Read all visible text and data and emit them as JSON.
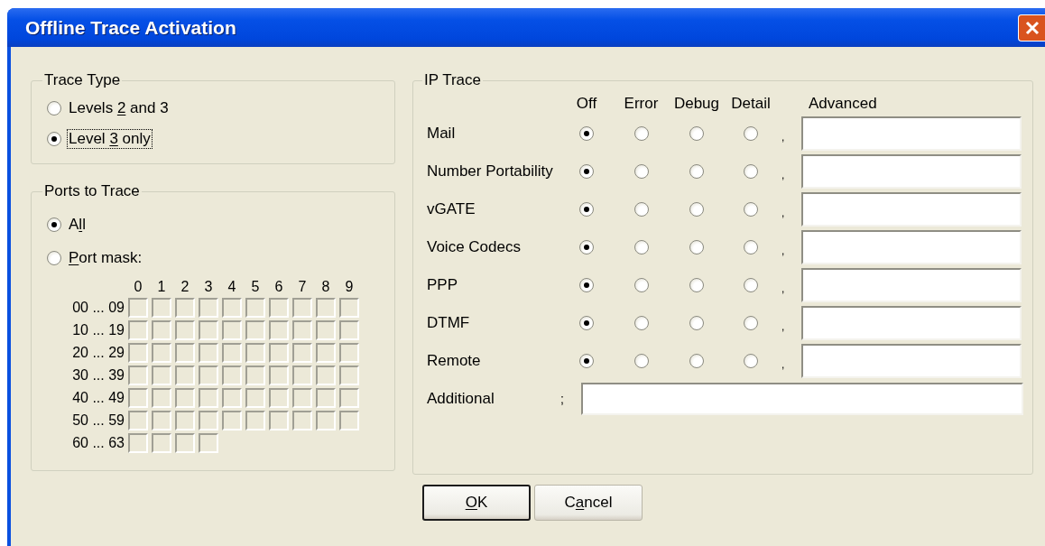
{
  "window": {
    "title": "Offline Trace Activation"
  },
  "trace_type": {
    "title": "Trace Type",
    "options": [
      {
        "label": {
          "before": "Levels ",
          "key": "2",
          "after": " and 3"
        },
        "selected": false,
        "focused": false
      },
      {
        "label": {
          "before": "Level ",
          "key": "3",
          "after": " only"
        },
        "selected": true,
        "focused": true
      }
    ]
  },
  "ports_to_trace": {
    "title": "Ports to Trace",
    "options": [
      {
        "label": {
          "before": "A",
          "key": "l",
          "after": "l"
        },
        "selected": true,
        "focused": false
      },
      {
        "label": {
          "key": "P",
          "after": "ort mask:"
        },
        "selected": false,
        "focused": false
      }
    ],
    "port_mask": {
      "column_headers": [
        "0",
        "1",
        "2",
        "3",
        "4",
        "5",
        "6",
        "7",
        "8",
        "9"
      ],
      "rows": [
        {
          "label": "00 ... 09",
          "boxes": [
            {
              "checked": false
            },
            {
              "checked": false
            },
            {
              "checked": false
            },
            {
              "checked": false
            },
            {
              "checked": false
            },
            {
              "checked": false
            },
            {
              "checked": false
            },
            {
              "checked": false
            },
            {
              "checked": false
            },
            {
              "checked": false
            }
          ]
        },
        {
          "label": "10 ... 19",
          "boxes": [
            {
              "checked": false
            },
            {
              "checked": false
            },
            {
              "checked": false
            },
            {
              "checked": false
            },
            {
              "checked": false
            },
            {
              "checked": false
            },
            {
              "checked": false
            },
            {
              "checked": false
            },
            {
              "checked": false
            },
            {
              "checked": false
            }
          ]
        },
        {
          "label": "20 ... 29",
          "boxes": [
            {
              "checked": false
            },
            {
              "checked": false
            },
            {
              "checked": false
            },
            {
              "checked": false
            },
            {
              "checked": false
            },
            {
              "checked": false
            },
            {
              "checked": false
            },
            {
              "checked": false
            },
            {
              "checked": false
            },
            {
              "checked": false
            }
          ]
        },
        {
          "label": "30 ... 39",
          "boxes": [
            {
              "checked": false
            },
            {
              "checked": false
            },
            {
              "checked": false
            },
            {
              "checked": false
            },
            {
              "checked": false
            },
            {
              "checked": false
            },
            {
              "checked": false
            },
            {
              "checked": false
            },
            {
              "checked": false
            },
            {
              "checked": false
            }
          ]
        },
        {
          "label": "40 ... 49",
          "boxes": [
            {
              "checked": false
            },
            {
              "checked": false
            },
            {
              "checked": false
            },
            {
              "checked": false
            },
            {
              "checked": false
            },
            {
              "checked": false
            },
            {
              "checked": false
            },
            {
              "checked": false
            },
            {
              "checked": false
            },
            {
              "checked": false
            }
          ]
        },
        {
          "label": "50 ... 59",
          "boxes": [
            {
              "checked": false
            },
            {
              "checked": false
            },
            {
              "checked": false
            },
            {
              "checked": false
            },
            {
              "checked": false
            },
            {
              "checked": false
            },
            {
              "checked": false
            },
            {
              "checked": false
            },
            {
              "checked": false
            },
            {
              "checked": false
            }
          ]
        },
        {
          "label": "60 ... 63",
          "boxes": [
            {
              "checked": false
            },
            {
              "checked": false
            },
            {
              "checked": false
            },
            {
              "checked": false
            }
          ]
        }
      ]
    }
  },
  "ip_trace": {
    "title": "IP Trace",
    "columns": [
      "Off",
      "Error",
      "Debug",
      "Detail"
    ],
    "advanced_heading": "Advanced",
    "rows": [
      {
        "label": "Mail",
        "levels": [
          {
            "selected": true
          },
          {
            "selected": false
          },
          {
            "selected": false
          },
          {
            "selected": false
          }
        ],
        "separator": ","
      },
      {
        "label": "Number Portability",
        "levels": [
          {
            "selected": true
          },
          {
            "selected": false
          },
          {
            "selected": false
          },
          {
            "selected": false
          }
        ],
        "separator": ","
      },
      {
        "label": "vGATE",
        "levels": [
          {
            "selected": true
          },
          {
            "selected": false
          },
          {
            "selected": false
          },
          {
            "selected": false
          }
        ],
        "separator": ","
      },
      {
        "label": "Voice Codecs",
        "levels": [
          {
            "selected": true
          },
          {
            "selected": false
          },
          {
            "selected": false
          },
          {
            "selected": false
          }
        ],
        "separator": ","
      },
      {
        "label": "PPP",
        "levels": [
          {
            "selected": true
          },
          {
            "selected": false
          },
          {
            "selected": false
          },
          {
            "selected": false
          }
        ],
        "separator": ","
      },
      {
        "label": "DTMF",
        "levels": [
          {
            "selected": true
          },
          {
            "selected": false
          },
          {
            "selected": false
          },
          {
            "selected": false
          }
        ],
        "separator": ","
      },
      {
        "label": "Remote",
        "levels": [
          {
            "selected": true
          },
          {
            "selected": false
          },
          {
            "selected": false
          },
          {
            "selected": false
          }
        ],
        "separator": ","
      }
    ],
    "additional": {
      "label": "Additional",
      "separator": ";"
    }
  },
  "buttons": [
    {
      "label": {
        "key": "O",
        "after": "K"
      },
      "default": true
    },
    {
      "label": {
        "before": "C",
        "key": "a",
        "after": "ncel"
      },
      "default": false
    }
  ]
}
